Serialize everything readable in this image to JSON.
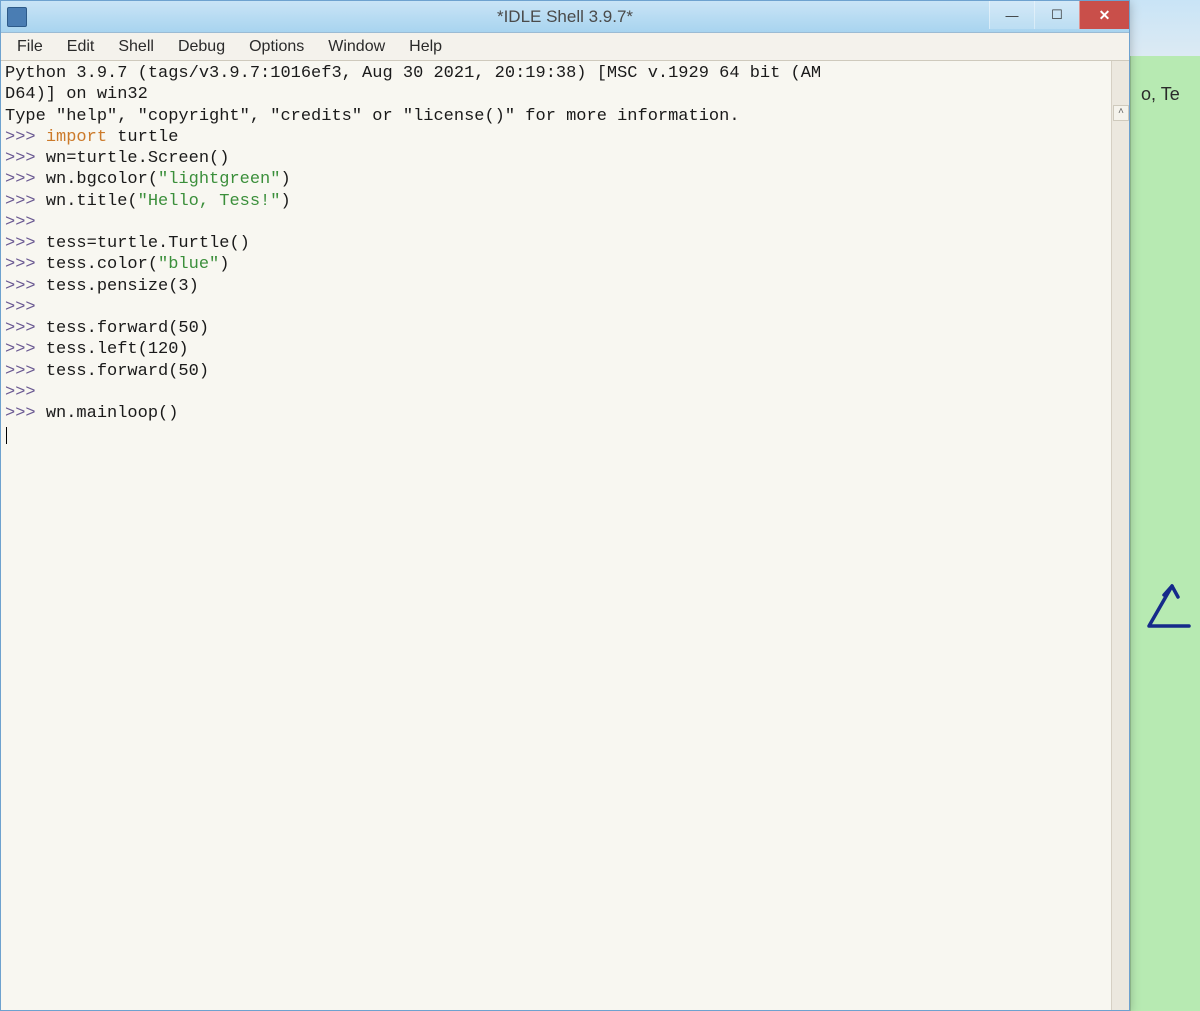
{
  "titlebar": {
    "title": "*IDLE Shell 3.9.7*",
    "minimize_glyph": "—",
    "maximize_glyph": "☐",
    "close_glyph": "✕"
  },
  "menubar": {
    "items": [
      "File",
      "Edit",
      "Shell",
      "Debug",
      "Options",
      "Window",
      "Help"
    ]
  },
  "shell": {
    "banner_line1": "Python 3.9.7 (tags/v3.9.7:1016ef3, Aug 30 2021, 20:19:38) [MSC v.1929 64 bit (AM",
    "banner_line2": "D64)] on win32",
    "banner_line3_pre": "Type \"help\", \"copyright\", \"credits\" or \"license()\" for more information.",
    "prompt": ">>> ",
    "lines": [
      {
        "kw": "import",
        "rest": " turtle"
      },
      {
        "rest": "wn=turtle.Screen()"
      },
      {
        "rest_pre": "wn.bgcolor(",
        "str": "\"lightgreen\"",
        "rest_post": ")"
      },
      {
        "rest_pre": "wn.title(",
        "str": "\"Hello, Tess!\"",
        "rest_post": ")"
      },
      {
        "rest": ""
      },
      {
        "rest": "tess=turtle.Turtle()"
      },
      {
        "rest_pre": "tess.color(",
        "str": "\"blue\"",
        "rest_post": ")"
      },
      {
        "rest": "tess.pensize(3)"
      },
      {
        "rest": ""
      },
      {
        "rest": "tess.forward(50)"
      },
      {
        "rest": "tess.left(120)"
      },
      {
        "rest": "tess.forward(50)"
      },
      {
        "rest": ""
      },
      {
        "rest": "wn.mainloop()"
      }
    ],
    "scroll_up_glyph": "˄"
  },
  "bg_window": {
    "title_fragment": "o, Te"
  }
}
